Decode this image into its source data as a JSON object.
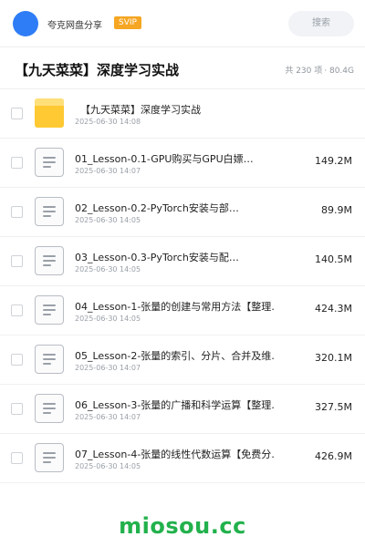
{
  "header": {
    "brand": "夸克网盘分享",
    "badge": "SVIP",
    "search_label": "搜索",
    "avatar_color": "#2f7df6",
    "badge_color": "#f5a623"
  },
  "page": {
    "title": "【九天菜菜】深度学习实战",
    "item_count": "共 230 项",
    "total_size": "· 80.4G"
  },
  "items": [
    {
      "type": "folder",
      "icon": "folder-icon",
      "name": "【九天菜菜】深度学习实战",
      "date": "2025-06-30 14:08",
      "size": ""
    },
    {
      "type": "file",
      "icon": "file-icon",
      "name": "01_Lesson-0.1-GPU购买与GPU白嫖…",
      "date": "2025-06-30 14:07",
      "size": "149.2M"
    },
    {
      "type": "file",
      "icon": "file-icon",
      "name": "02_Lesson-0.2-PyTorch安装与部…",
      "date": "2025-06-30 14:05",
      "size": "89.9M"
    },
    {
      "type": "file",
      "icon": "file-icon",
      "name": "03_Lesson-0.3-PyTorch安装与配…",
      "date": "2025-06-30 14:05",
      "size": "140.5M"
    },
    {
      "type": "file",
      "icon": "file-icon",
      "name": "04_Lesson-1-张量的创建与常用方法【整理…",
      "date": "2025-06-30 14:05",
      "size": "424.3M"
    },
    {
      "type": "file",
      "icon": "file-icon",
      "name": "05_Lesson-2-张量的索引、分片、合并及维…",
      "date": "2025-06-30 14:07",
      "size": "320.1M"
    },
    {
      "type": "file",
      "icon": "file-icon",
      "name": "06_Lesson-3-张量的广播和科学运算【整理…",
      "date": "2025-06-30 14:07",
      "size": "327.5M"
    },
    {
      "type": "file",
      "icon": "file-icon",
      "name": "07_Lesson-4-张量的线性代数运算【免费分…",
      "date": "2025-06-30 14:05",
      "size": "426.9M"
    }
  ],
  "watermark": "miosou.cc"
}
